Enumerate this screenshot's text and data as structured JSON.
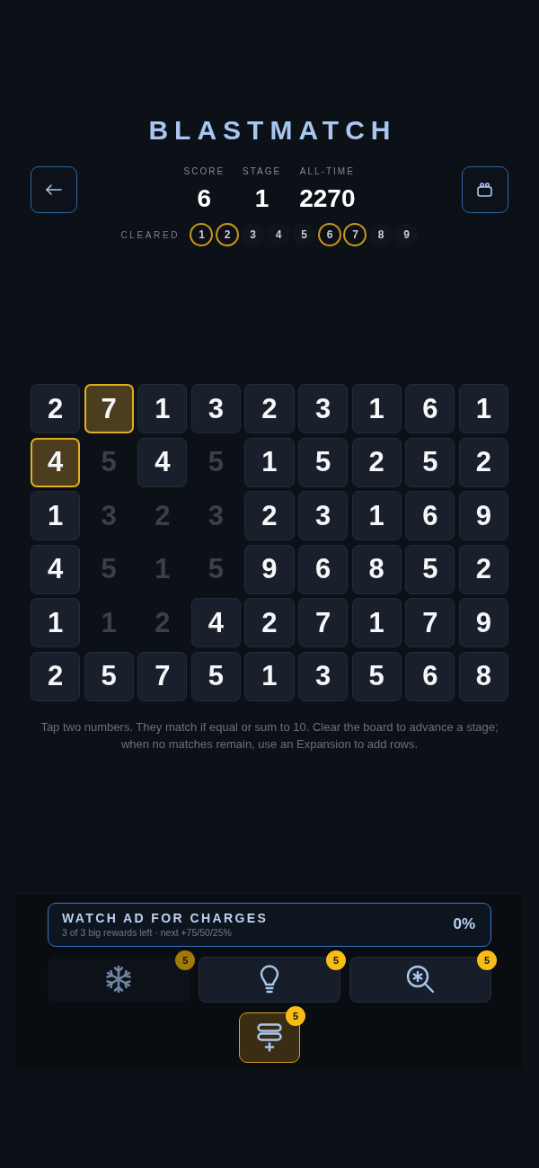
{
  "title": "BLASTMATCH",
  "stats": [
    {
      "label": "SCORE",
      "value": "6"
    },
    {
      "label": "STAGE",
      "value": "1"
    },
    {
      "label": "ALL-TIME",
      "value": "2270"
    }
  ],
  "cleared": {
    "label": "CLEARED",
    "stages": [
      {
        "number": "1",
        "cleared": true
      },
      {
        "number": "2",
        "cleared": true
      },
      {
        "number": "3",
        "cleared": false
      },
      {
        "number": "4",
        "cleared": false
      },
      {
        "number": "5",
        "cleared": false
      },
      {
        "number": "6",
        "cleared": true
      },
      {
        "number": "7",
        "cleared": true
      },
      {
        "number": "8",
        "cleared": false
      },
      {
        "number": "9",
        "cleared": false
      }
    ]
  },
  "board": {
    "rows": [
      [
        {
          "value": "2",
          "selected": false,
          "cleared": false
        },
        {
          "value": "7",
          "selected": true,
          "cleared": false
        },
        {
          "value": "1",
          "selected": false,
          "cleared": false
        },
        {
          "value": "3",
          "selected": false,
          "cleared": false
        },
        {
          "value": "2",
          "selected": false,
          "cleared": false
        },
        {
          "value": "3",
          "selected": false,
          "cleared": false
        },
        {
          "value": "1",
          "selected": false,
          "cleared": false
        },
        {
          "value": "6",
          "selected": false,
          "cleared": false
        },
        {
          "value": "1",
          "selected": false,
          "cleared": false
        }
      ],
      [
        {
          "value": "4",
          "selected": true,
          "cleared": false
        },
        {
          "value": "5",
          "selected": false,
          "cleared": true
        },
        {
          "value": "4",
          "selected": false,
          "cleared": false
        },
        {
          "value": "5",
          "selected": false,
          "cleared": true
        },
        {
          "value": "1",
          "selected": false,
          "cleared": false
        },
        {
          "value": "5",
          "selected": false,
          "cleared": false
        },
        {
          "value": "2",
          "selected": false,
          "cleared": false
        },
        {
          "value": "5",
          "selected": false,
          "cleared": false
        },
        {
          "value": "2",
          "selected": false,
          "cleared": false
        }
      ],
      [
        {
          "value": "1",
          "selected": false,
          "cleared": false
        },
        {
          "value": "3",
          "selected": false,
          "cleared": true
        },
        {
          "value": "2",
          "selected": false,
          "cleared": true
        },
        {
          "value": "3",
          "selected": false,
          "cleared": true
        },
        {
          "value": "2",
          "selected": false,
          "cleared": false
        },
        {
          "value": "3",
          "selected": false,
          "cleared": false
        },
        {
          "value": "1",
          "selected": false,
          "cleared": false
        },
        {
          "value": "6",
          "selected": false,
          "cleared": false
        },
        {
          "value": "9",
          "selected": false,
          "cleared": false
        }
      ],
      [
        {
          "value": "4",
          "selected": false,
          "cleared": false
        },
        {
          "value": "5",
          "selected": false,
          "cleared": true
        },
        {
          "value": "1",
          "selected": false,
          "cleared": true
        },
        {
          "value": "5",
          "selected": false,
          "cleared": true
        },
        {
          "value": "9",
          "selected": false,
          "cleared": false
        },
        {
          "value": "6",
          "selected": false,
          "cleared": false
        },
        {
          "value": "8",
          "selected": false,
          "cleared": false
        },
        {
          "value": "5",
          "selected": false,
          "cleared": false
        },
        {
          "value": "2",
          "selected": false,
          "cleared": false
        }
      ],
      [
        {
          "value": "1",
          "selected": false,
          "cleared": false
        },
        {
          "value": "1",
          "selected": false,
          "cleared": true
        },
        {
          "value": "2",
          "selected": false,
          "cleared": true
        },
        {
          "value": "4",
          "selected": false,
          "cleared": false
        },
        {
          "value": "2",
          "selected": false,
          "cleared": false
        },
        {
          "value": "7",
          "selected": false,
          "cleared": false
        },
        {
          "value": "1",
          "selected": false,
          "cleared": false
        },
        {
          "value": "7",
          "selected": false,
          "cleared": false
        },
        {
          "value": "9",
          "selected": false,
          "cleared": false
        }
      ],
      [
        {
          "value": "2",
          "selected": false,
          "cleared": false
        },
        {
          "value": "5",
          "selected": false,
          "cleared": false
        },
        {
          "value": "7",
          "selected": false,
          "cleared": false
        },
        {
          "value": "5",
          "selected": false,
          "cleared": false
        },
        {
          "value": "1",
          "selected": false,
          "cleared": false
        },
        {
          "value": "3",
          "selected": false,
          "cleared": false
        },
        {
          "value": "5",
          "selected": false,
          "cleared": false
        },
        {
          "value": "6",
          "selected": false,
          "cleared": false
        },
        {
          "value": "8",
          "selected": false,
          "cleared": false
        }
      ]
    ]
  },
  "hint": "Tap two numbers. They match if equal or sum to 10. Clear the board to advance a stage; when no matches remain, use an Expansion to add rows.",
  "ad_banner": {
    "title": "WATCH AD FOR CHARGES",
    "subtitle": "3 of 3 big rewards left · next +75/50/25%",
    "percent": "0%"
  },
  "powerups": [
    {
      "kind": "freeze",
      "badge": "5",
      "disabled": true
    },
    {
      "kind": "hint",
      "badge": "5",
      "disabled": false
    },
    {
      "kind": "scan",
      "badge": "5",
      "disabled": false
    }
  ],
  "expansion": {
    "badge": "5",
    "highlighted": true
  }
}
